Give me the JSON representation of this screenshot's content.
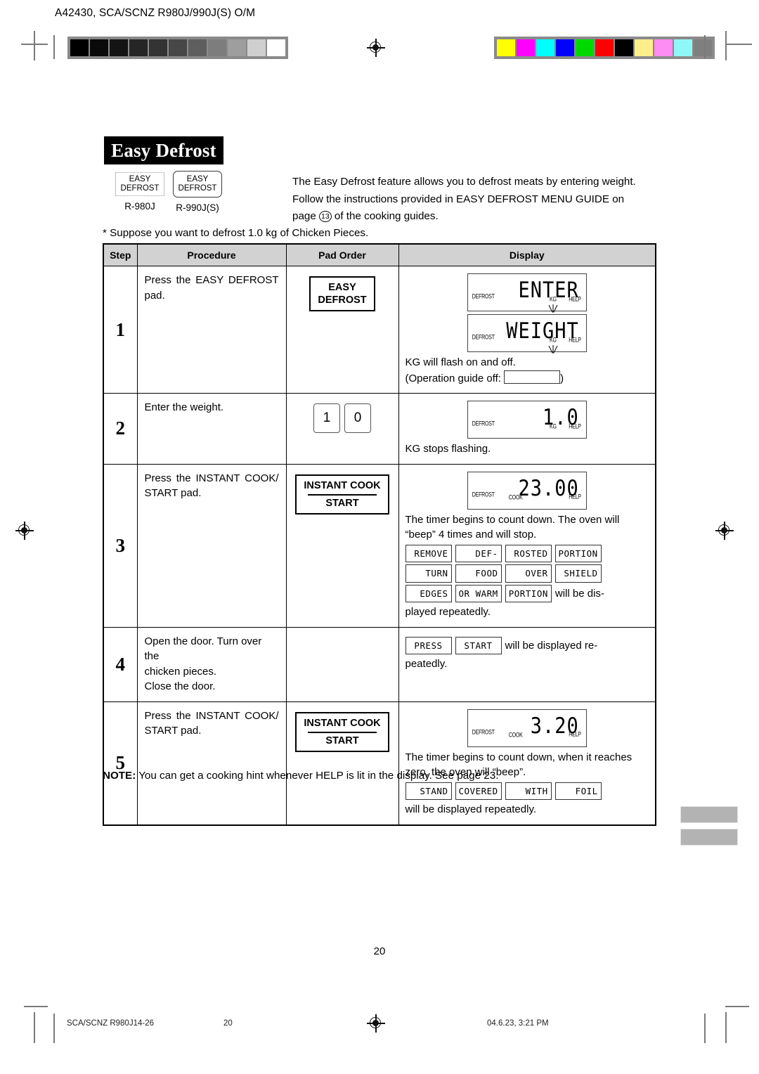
{
  "header": {
    "doc_code": "A42430, SCA/SCNZ R980J/990J(S) O/M",
    "gray_swatches": [
      "#000000",
      "#0a0a0a",
      "#141414",
      "#262626",
      "#333333",
      "#474747",
      "#5e5e5e",
      "#7d7d7d",
      "#9e9e9e",
      "#cfcfcf",
      "#ffffff"
    ],
    "color_swatches": [
      "#ffff00",
      "#ff00ff",
      "#00ffff",
      "#0000ff",
      "#00d900",
      "#ff0000",
      "#000000",
      "#ffef8a",
      "#ff8cf0",
      "#90f7f7",
      "#7f7f7f"
    ]
  },
  "title": "Easy Defrost",
  "pads": {
    "left": {
      "line1": "EASY",
      "line2": "DEFROST",
      "model": "R-980J"
    },
    "right": {
      "line1": "EASY",
      "line2": "DEFROST",
      "model": "R-990J(S)"
    }
  },
  "intro": {
    "line1": "The Easy Defrost feature allows you to defrost meats by entering weight.",
    "line2": "Follow the instructions provided in EASY DEFROST MENU GUIDE on",
    "line3_pre": "page ",
    "line3_ref": "13",
    "line3_post": " of the cooking guides."
  },
  "suppose": "* Suppose you want to defrost 1.0 kg of Chicken Pieces.",
  "table": {
    "columns": [
      "Step",
      "Procedure",
      "Pad Order",
      "Display"
    ],
    "rows": [
      {
        "step": "1",
        "procedure": "Press the EASY DEFROST pad.",
        "pad": {
          "type": "button",
          "line1": "EASY",
          "line2": "DEFROST"
        },
        "display": {
          "lcds": [
            {
              "left": "DEFROST",
              "main": "ENTER",
              "kg": "KG",
              "help": "HELP",
              "kg_flashing": true
            },
            {
              "left": "DEFROST",
              "main": "WEIGHT",
              "kg": "KG",
              "help": "HELP",
              "kg_flashing": true
            }
          ],
          "text1": "KG will flash on and off.",
          "text2_pre": "(Operation guide off: ",
          "text2_post": ")"
        }
      },
      {
        "step": "2",
        "procedure": "Enter the weight.",
        "pad": {
          "type": "numbers",
          "keys": [
            "1",
            "0"
          ]
        },
        "display": {
          "lcds": [
            {
              "left": "DEFROST",
              "main": "1.0",
              "kg": "KG",
              "help": "HELP",
              "kg_flashing": false
            }
          ],
          "text1": "KG stops flashing."
        }
      },
      {
        "step": "3",
        "procedure": "Press the INSTANT COOK/ START pad.",
        "pad": {
          "type": "button",
          "line1": "INSTANT COOK",
          "line2": "START",
          "divider": true
        },
        "display": {
          "lcds": [
            {
              "left": "DEFROST",
              "main": "23.00",
              "cook": "COOK",
              "help": "HELP"
            }
          ],
          "text1": "The timer begins to count down. The oven will “beep” 4 times and will stop.",
          "tokens": [
            [
              "REMOVE",
              "DEF-",
              "ROSTED",
              "PORTION"
            ],
            [
              "TURN",
              "FOOD",
              "OVER",
              "SHIELD"
            ],
            [
              "EDGES",
              "OR WARM",
              "PORTION"
            ]
          ],
          "tokens_tail": " will be dis-",
          "text2": "played repeatedly."
        }
      },
      {
        "step": "4",
        "procedure": "Open the door. Turn over the chicken pieces.\nClose the door.",
        "procedure_lines": [
          "Open the door. Turn over the",
          "chicken pieces.",
          "Close the door."
        ],
        "pad": {
          "type": "none"
        },
        "display": {
          "inline_tokens": [
            "PRESS",
            "START"
          ],
          "inline_tail": " will be displayed re-",
          "text2": "peatedly."
        }
      },
      {
        "step": "5",
        "procedure": "Press the INSTANT COOK/ START pad.",
        "pad": {
          "type": "button",
          "line1": "INSTANT COOK",
          "line2": "START",
          "divider": true
        },
        "display": {
          "lcds": [
            {
              "left": "DEFROST",
              "main": "3.20",
              "cook": "COOK",
              "help": "HELP"
            }
          ],
          "text1": "The timer begins to count down, when it reaches zero, the oven will “beep”.",
          "tokens": [
            [
              "STAND",
              "COVERED",
              "WITH",
              "FOIL"
            ]
          ],
          "text2": "will be displayed repeatedly."
        }
      }
    ]
  },
  "note": {
    "label": "NOTE:",
    "text": " You can get a cooking hint whenever HELP is lit in the display. See page 23."
  },
  "page_number": "20",
  "footer": {
    "left": "SCA/SCNZ R980J14-26",
    "center": "20",
    "right": "04.6.23, 3:21 PM"
  }
}
